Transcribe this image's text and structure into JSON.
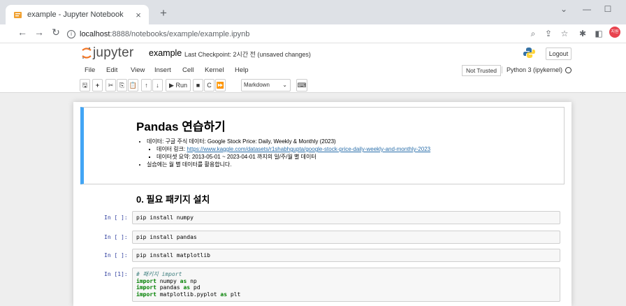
{
  "browser": {
    "tab_title": "example - Jupyter Notebook",
    "tab_close": "×",
    "new_tab": "+",
    "url_host": "localhost",
    "url_path": ":8888/notebooks/example/example.ipynb",
    "profile_initials": "지원"
  },
  "jupyter": {
    "logo_text": "jupyter",
    "notebook_name": "example",
    "checkpoint": "Last Checkpoint: 2시간 전  (unsaved changes)",
    "logout_label": "Logout",
    "menu": [
      "File",
      "Edit",
      "View",
      "Insert",
      "Cell",
      "Kernel",
      "Help"
    ],
    "trusted_label": "Not Trusted",
    "kernel_label": "Python 3 (ipykernel)",
    "run_label": "Run",
    "cell_type": "Markdown"
  },
  "notebook": {
    "title": "Pandas 연습하기",
    "bullet1": "데이터: 구글 주식 데이터: Google Stock Price: Daily, Weekly & Monthly (2023)",
    "sub1_prefix": "데이터 링크: ",
    "sub1_link": "https://www.kaggle.com/datasets/r1shabhgupta/google-stock-price-daily-weekly-and-monthly-2023",
    "sub2": "데이터셋 요약: 2013-05-01 ~ 2023-04-01 까지의 일/주/월 별 데이터",
    "bullet2": "실습에는 월 별 데이터를 활용합니다.",
    "section_title": "0. 필요 패키지 설치",
    "cells": [
      {
        "prompt": "In [ ]:",
        "code": "pip install numpy"
      },
      {
        "prompt": "In [ ]:",
        "code": "pip install pandas"
      },
      {
        "prompt": "In [ ]:",
        "code": "pip install matplotlib"
      },
      {
        "prompt": "In [1]:",
        "comment": "# 패키지 import",
        "lines": [
          {
            "kw": "import",
            "rest1": " numpy ",
            "kw2": "as",
            "rest2": " np"
          },
          {
            "kw": "import",
            "rest1": " pandas ",
            "kw2": "as",
            "rest2": " pd"
          },
          {
            "kw": "import",
            "rest1": " matplotlib.pyplot ",
            "kw2": "as",
            "rest2": " plt"
          }
        ]
      }
    ]
  }
}
